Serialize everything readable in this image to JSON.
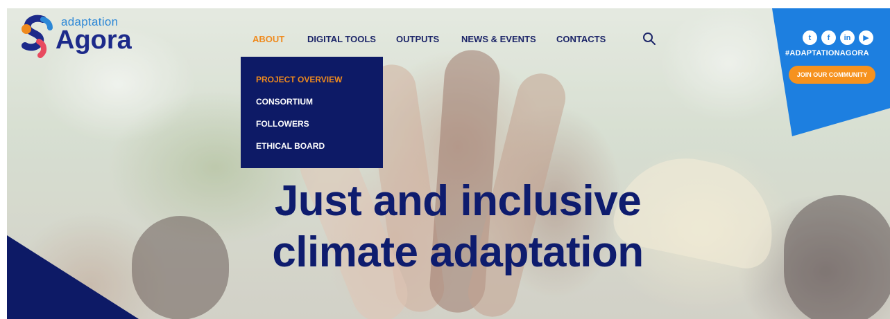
{
  "logo": {
    "small": "adaptation",
    "big": "Agora"
  },
  "nav": {
    "items": [
      "ABOUT",
      "DIGITAL TOOLS",
      "OUTPUTS",
      "NEWS & EVENTS",
      "CONTACTS"
    ],
    "active": "ABOUT"
  },
  "dropdown": {
    "items": [
      "PROJECT OVERVIEW",
      "CONSORTIUM",
      "FOLLOWERS",
      "ETHICAL BOARD"
    ],
    "active": "PROJECT OVERVIEW"
  },
  "social": {
    "icons": [
      "twitter-icon",
      "facebook-icon",
      "linkedin-icon",
      "youtube-icon"
    ],
    "icon_glyphs": [
      "t",
      "f",
      "in",
      "▶"
    ],
    "hashtag": "#ADAPTATIONAGORA",
    "join_label": "JOIN OUR COMMUNITY"
  },
  "hero": {
    "headline_line1": "Just and inclusive",
    "headline_line2": "climate adaptation"
  },
  "colors": {
    "navy": "#0d1a66",
    "orange": "#ef8a1d",
    "blue": "#1d7fe0"
  }
}
